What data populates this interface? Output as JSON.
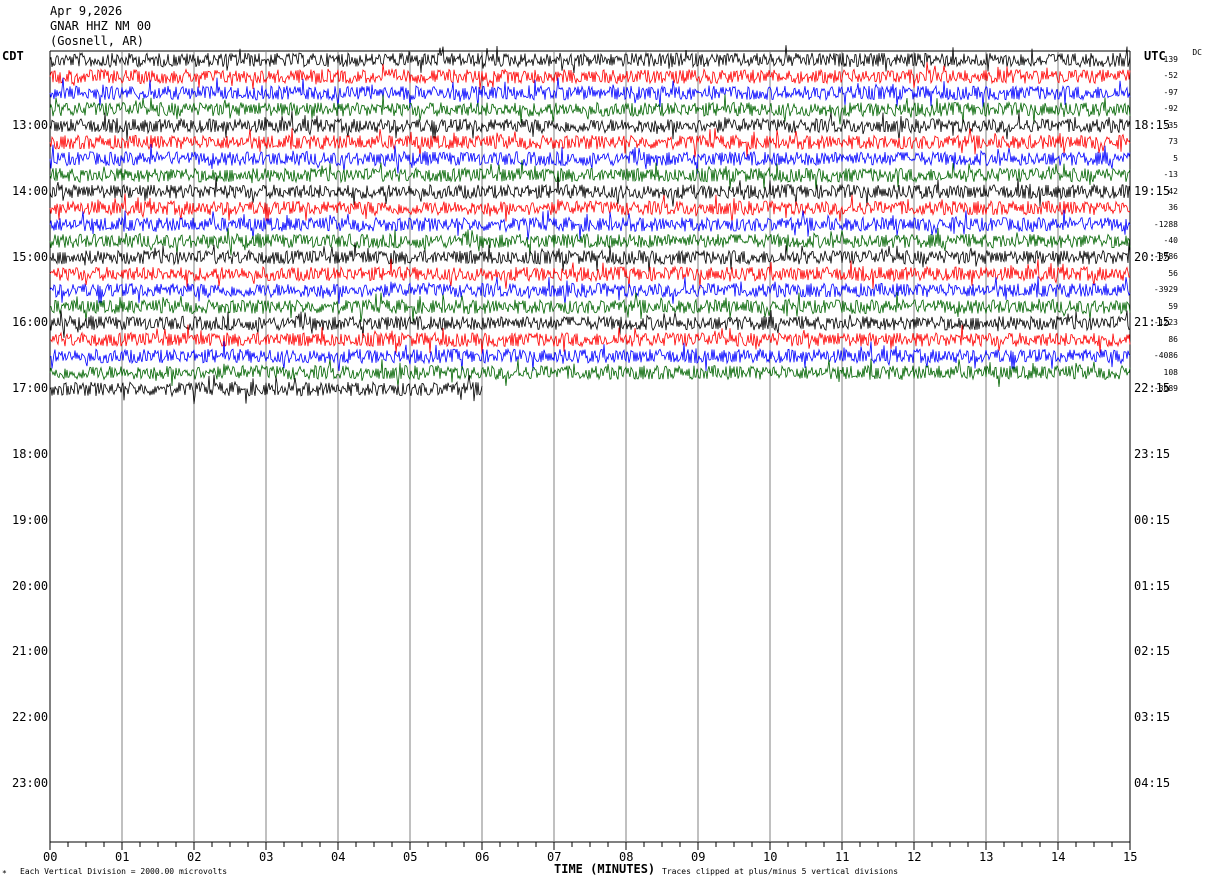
{
  "header": {
    "date": "Apr 9,2026",
    "station": "GNAR HHZ NM 00",
    "location": "(Gosnell, AR)"
  },
  "left_axis_label": "CDT",
  "right_axis_label": "UTC",
  "dc_label": "DC",
  "footer": {
    "scale": "Each Vertical Division = 2000.00 microvolts",
    "clip": "Traces clipped at plus/minus 5 vertical divisions",
    "mark": "*"
  },
  "colors": {
    "trace_cycle": [
      "#000000",
      "#ff0000",
      "#0000ff",
      "#006400"
    ],
    "grid": "#808080"
  },
  "chart_data": {
    "type": "line",
    "title": "Apr 9,2026 GNAR HHZ NM 00 (Gosnell, AR)",
    "xlabel": "TIME (MINUTES)",
    "x_ticks": [
      "00",
      "01",
      "02",
      "03",
      "04",
      "05",
      "06",
      "07",
      "08",
      "09",
      "10",
      "11",
      "12",
      "13",
      "14",
      "15"
    ],
    "xlim": [
      0,
      15
    ],
    "left_hour_labels": [
      "13:00",
      "14:00",
      "15:00",
      "16:00",
      "17:00",
      "18:00",
      "19:00",
      "20:00",
      "21:00",
      "22:00",
      "23:00"
    ],
    "right_hour_labels": [
      "18:15",
      "19:15",
      "20:15",
      "21:15",
      "22:15",
      "23:15",
      "00:15",
      "01:15",
      "02:15",
      "03:15",
      "04:15"
    ],
    "dc_offsets": [
      "139",
      "-52",
      "-97",
      "-92",
      "-35",
      "73",
      "5",
      "-13",
      "42",
      "36",
      "-1288",
      "-40",
      "-3786",
      "56",
      "-3929",
      "59",
      "-1223",
      "86",
      "-4086",
      "108",
      "-3089"
    ],
    "traces_minutes_recorded": [
      15,
      15,
      15,
      15,
      15,
      15,
      15,
      15,
      15,
      15,
      15,
      15,
      15,
      15,
      15,
      15,
      15,
      15,
      15,
      15,
      6
    ]
  }
}
